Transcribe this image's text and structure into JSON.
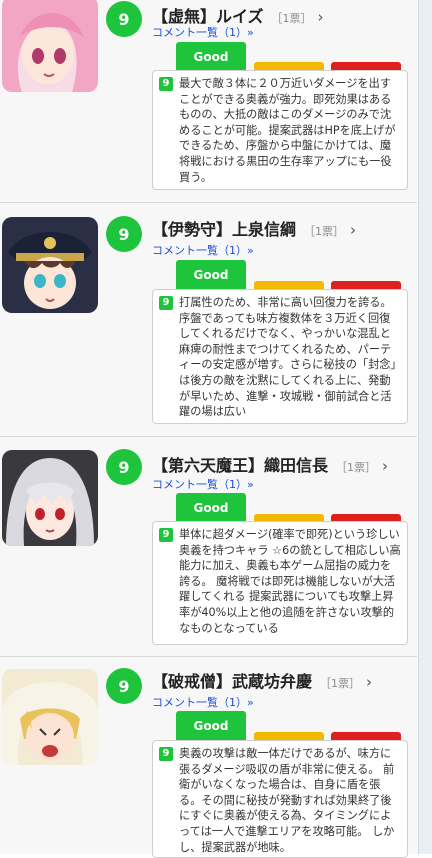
{
  "entries": [
    {
      "rank": "9",
      "name": "【虚無】ルイズ",
      "votes": "［1票］",
      "chevron": "›",
      "comment_link": "コメント一覧（1）»",
      "good_label": "Good",
      "comment_rank": "9",
      "comment": "最大で敵３体に２０万近いダメージを出すことができる奥義が強力。即死効果はあるものの、大抵の敵はこのダメージのみで沈めることが可能。提案武器はHPを底上げができるため、序盤から中盤にかけては、魔将戦における黒田の生存率アップにも一役買う。",
      "avatar_icon": "character-portrait-pink-hair"
    },
    {
      "rank": "9",
      "name": "【伊勢守】上泉信綱",
      "votes": "［1票］",
      "chevron": "›",
      "comment_link": "コメント一覧（1）»",
      "good_label": "Good",
      "comment_rank": "9",
      "comment": "打属性のため、非常に高い回復力を誇る。序盤であっても味方複数体を３万近く回復してくれるだけでなく、やっかいな混乱と麻痺の耐性までつけてくれるため、パーティーの安定感が増す。さらに秘技の「封念」は後方の敵を沈黙にしてくれる上に、発動が早いため、進撃・攻城戦・御前試合と活躍の場は広い",
      "avatar_icon": "character-portrait-military-cap"
    },
    {
      "rank": "9",
      "name": "【第六天魔王】織田信長",
      "votes": "［1票］",
      "chevron": "›",
      "comment_link": "コメント一覧（1）»",
      "good_label": "Good",
      "comment_rank": "9",
      "comment": "単体に超ダメージ(確率で即死)という珍しい奥義を持つキャラ ☆6の銃として相応しい高能力に加え、奥義も本ゲーム屈指の威力を誇る。 魔将戦では即死は機能しないが大活躍してくれる 提案武器についても攻撃上昇率が40%以上と他の追随を許さない攻撃的なものとなっている",
      "avatar_icon": "character-portrait-silver-hair"
    },
    {
      "rank": "9",
      "name": "【破戒僧】武蔵坊弁慶",
      "votes": "［1票］",
      "chevron": "›",
      "comment_link": "コメント一覧（1）»",
      "good_label": "Good",
      "comment_rank": "9",
      "comment": "奥義の攻撃は敵一体だけであるが、味方に張るダメージ吸収の盾が非常に使える。 前衛がいなくなった場合は、自身に盾を張る。その間に秘技が発動すれば効果終了後にすぐに奥義が使える為、タイミングによっては一人で進撃エリアを攻略可能。 しかし、提案武器が地味。",
      "avatar_icon": "character-portrait-blonde-hood"
    }
  ]
}
